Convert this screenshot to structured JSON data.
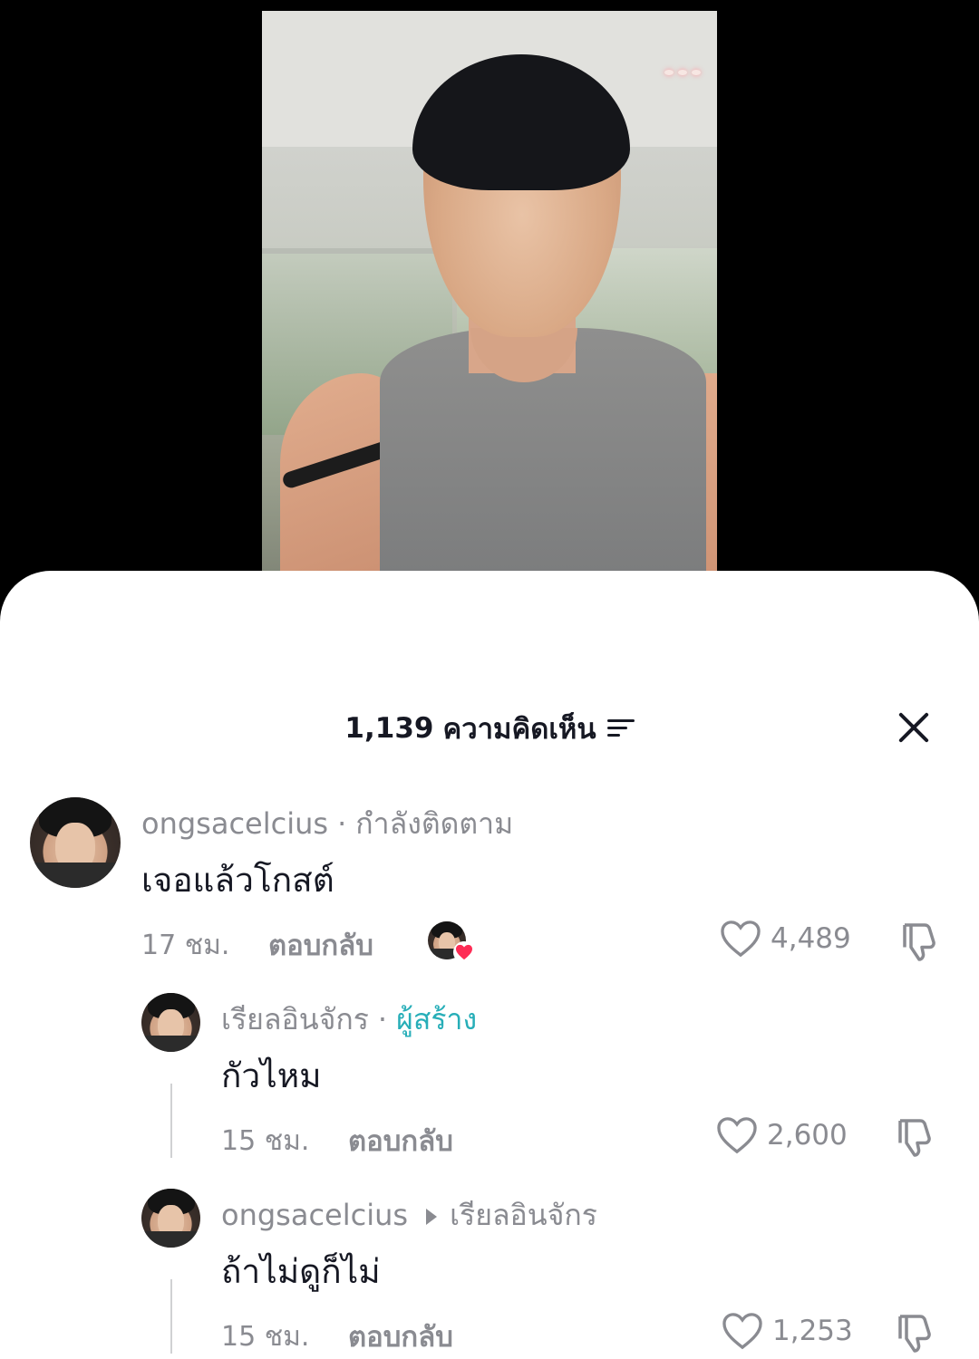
{
  "sheet": {
    "comment_count": "1,139",
    "comments_label": "ความคิดเห็น"
  },
  "comments": [
    {
      "username": "ongsacelcius",
      "separator": "·",
      "status": "กำลังติดตาม",
      "text": "เจอแล้วโกสต์",
      "time": "17 ชม.",
      "reply_label": "ตอบกลับ",
      "likes": "4,489"
    },
    {
      "username": "เรียลอินจักร",
      "separator": "·",
      "badge": "ผู้สร้าง",
      "text": "กัวไหม",
      "time": "15 ชม.",
      "reply_label": "ตอบกลับ",
      "likes": "2,600"
    },
    {
      "username": "ongsacelcius",
      "reply_to": "เรียลอินจักร",
      "text": "ถ้าไม่ดูก็ไม่",
      "time": "15 ชม.",
      "reply_label": "ตอบกลับ",
      "likes": "1,253"
    }
  ],
  "icons": {
    "filter": "sort-filter-icon",
    "close": "close-icon",
    "like": "heart-outline-icon",
    "dislike": "thumbs-down-icon",
    "liked_by_creator": "creator-heart-icon"
  },
  "colors": {
    "creator_badge": "#27aeb8",
    "heart_red": "#fe2c55",
    "secondary_text": "#8a8b91",
    "primary_text": "#161823"
  }
}
